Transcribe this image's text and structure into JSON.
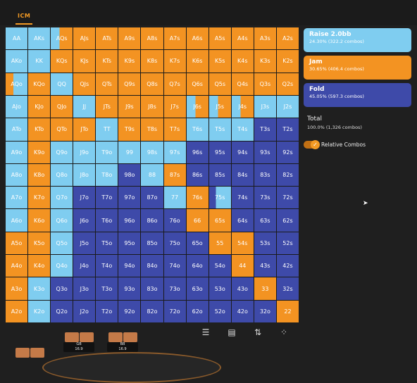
{
  "header": {
    "tab_label": "ICM"
  },
  "grid": {
    "rows": [
      [
        [
          "AA",
          "R"
        ],
        [
          "AKs",
          "R"
        ],
        [
          "AQs",
          "RJ"
        ],
        [
          "AJs",
          "J"
        ],
        [
          "ATs",
          "J"
        ],
        [
          "A9s",
          "J"
        ],
        [
          "A8s",
          "J"
        ],
        [
          "A7s",
          "J"
        ],
        [
          "A6s",
          "J"
        ],
        [
          "A5s",
          "J"
        ],
        [
          "A4s",
          "J"
        ],
        [
          "A3s",
          "J"
        ],
        [
          "A2s",
          "J"
        ]
      ],
      [
        [
          "AKo",
          "R"
        ],
        [
          "KK",
          "R"
        ],
        [
          "KQs",
          "J"
        ],
        [
          "KJs",
          "J"
        ],
        [
          "KTs",
          "J"
        ],
        [
          "K9s",
          "J"
        ],
        [
          "K8s",
          "J"
        ],
        [
          "K7s",
          "J"
        ],
        [
          "K6s",
          "J"
        ],
        [
          "K5s",
          "J"
        ],
        [
          "K4s",
          "J"
        ],
        [
          "K3s",
          "J"
        ],
        [
          "K2s",
          "J"
        ]
      ],
      [
        [
          "AQo",
          "JR"
        ],
        [
          "KQo",
          "J"
        ],
        [
          "QQ",
          "R"
        ],
        [
          "QJs",
          "J"
        ],
        [
          "QTs",
          "J"
        ],
        [
          "Q9s",
          "J"
        ],
        [
          "Q8s",
          "J"
        ],
        [
          "Q7s",
          "J"
        ],
        [
          "Q6s",
          "J"
        ],
        [
          "Q5s",
          "J"
        ],
        [
          "Q4s",
          "J"
        ],
        [
          "Q3s",
          "J"
        ],
        [
          "Q2s",
          "J"
        ]
      ],
      [
        [
          "AJo",
          "R"
        ],
        [
          "KJo",
          "J"
        ],
        [
          "QJo",
          "J"
        ],
        [
          "JJ",
          "R"
        ],
        [
          "JTs",
          "J"
        ],
        [
          "J9s",
          "J"
        ],
        [
          "J8s",
          "J"
        ],
        [
          "J7s",
          "J"
        ],
        [
          "J6s",
          "RJ"
        ],
        [
          "J5s",
          "RJ"
        ],
        [
          "J4s",
          "RJ"
        ],
        [
          "J3s",
          "R"
        ],
        [
          "J2s",
          "R"
        ]
      ],
      [
        [
          "ATo",
          "R"
        ],
        [
          "KTo",
          "J"
        ],
        [
          "QTo",
          "J"
        ],
        [
          "JTo",
          "J"
        ],
        [
          "TT",
          "R"
        ],
        [
          "T9s",
          "J"
        ],
        [
          "T8s",
          "J"
        ],
        [
          "T7s",
          "J"
        ],
        [
          "T6s",
          "R"
        ],
        [
          "T5s",
          "R"
        ],
        [
          "T4s",
          "R"
        ],
        [
          "T3s",
          "F"
        ],
        [
          "T2s",
          "F"
        ]
      ],
      [
        [
          "A9o",
          "R"
        ],
        [
          "K9o",
          "J"
        ],
        [
          "Q9o",
          "R"
        ],
        [
          "J9o",
          "R"
        ],
        [
          "T9o",
          "R"
        ],
        [
          "99",
          "R"
        ],
        [
          "98s",
          "R"
        ],
        [
          "97s",
          "R"
        ],
        [
          "96s",
          "F"
        ],
        [
          "95s",
          "F"
        ],
        [
          "94s",
          "F"
        ],
        [
          "93s",
          "F"
        ],
        [
          "92s",
          "F"
        ]
      ],
      [
        [
          "A8o",
          "R"
        ],
        [
          "K8o",
          "J"
        ],
        [
          "Q8o",
          "R"
        ],
        [
          "J8o",
          "R"
        ],
        [
          "T8o",
          "R"
        ],
        [
          "98o",
          "F"
        ],
        [
          "88",
          "R"
        ],
        [
          "87s",
          "J"
        ],
        [
          "86s",
          "F"
        ],
        [
          "85s",
          "F"
        ],
        [
          "84s",
          "F"
        ],
        [
          "83s",
          "F"
        ],
        [
          "82s",
          "F"
        ]
      ],
      [
        [
          "A7o",
          "R"
        ],
        [
          "K7o",
          "J"
        ],
        [
          "Q7o",
          "R"
        ],
        [
          "J7o",
          "F"
        ],
        [
          "T7o",
          "F"
        ],
        [
          "97o",
          "F"
        ],
        [
          "87o",
          "F"
        ],
        [
          "77",
          "R"
        ],
        [
          "76s",
          "J"
        ],
        [
          "75s",
          "FR"
        ],
        [
          "74s",
          "F"
        ],
        [
          "73s",
          "F"
        ],
        [
          "72s",
          "F"
        ]
      ],
      [
        [
          "A6o",
          "R"
        ],
        [
          "K6o",
          "J"
        ],
        [
          "Q6o",
          "R"
        ],
        [
          "J6o",
          "F"
        ],
        [
          "T6o",
          "F"
        ],
        [
          "96o",
          "F"
        ],
        [
          "86o",
          "F"
        ],
        [
          "76o",
          "F"
        ],
        [
          "66",
          "J"
        ],
        [
          "65s",
          "J"
        ],
        [
          "64s",
          "F"
        ],
        [
          "63s",
          "F"
        ],
        [
          "62s",
          "F"
        ]
      ],
      [
        [
          "A5o",
          "J"
        ],
        [
          "K5o",
          "J"
        ],
        [
          "Q5o",
          "R"
        ],
        [
          "J5o",
          "F"
        ],
        [
          "T5o",
          "F"
        ],
        [
          "95o",
          "F"
        ],
        [
          "85o",
          "F"
        ],
        [
          "75o",
          "F"
        ],
        [
          "65o",
          "F"
        ],
        [
          "55",
          "J"
        ],
        [
          "54s",
          "J"
        ],
        [
          "53s",
          "F"
        ],
        [
          "52s",
          "F"
        ]
      ],
      [
        [
          "A4o",
          "J"
        ],
        [
          "K4o",
          "J"
        ],
        [
          "Q4o",
          "R"
        ],
        [
          "J4o",
          "F"
        ],
        [
          "T4o",
          "F"
        ],
        [
          "94o",
          "F"
        ],
        [
          "84o",
          "F"
        ],
        [
          "74o",
          "F"
        ],
        [
          "64o",
          "F"
        ],
        [
          "54o",
          "F"
        ],
        [
          "44",
          "J"
        ],
        [
          "43s",
          "F"
        ],
        [
          "42s",
          "F"
        ]
      ],
      [
        [
          "A3o",
          "J"
        ],
        [
          "K3o",
          "R"
        ],
        [
          "Q3o",
          "F"
        ],
        [
          "J3o",
          "F"
        ],
        [
          "T3o",
          "F"
        ],
        [
          "93o",
          "F"
        ],
        [
          "83o",
          "F"
        ],
        [
          "73o",
          "F"
        ],
        [
          "63o",
          "F"
        ],
        [
          "53o",
          "F"
        ],
        [
          "43o",
          "F"
        ],
        [
          "33",
          "J"
        ],
        [
          "32s",
          "F"
        ]
      ],
      [
        [
          "A2o",
          "J"
        ],
        [
          "K2o",
          "R"
        ],
        [
          "Q2o",
          "F"
        ],
        [
          "J2o",
          "F"
        ],
        [
          "T2o",
          "F"
        ],
        [
          "92o",
          "F"
        ],
        [
          "82o",
          "F"
        ],
        [
          "72o",
          "F"
        ],
        [
          "62o",
          "F"
        ],
        [
          "52o",
          "F"
        ],
        [
          "42o",
          "F"
        ],
        [
          "32o",
          "F"
        ],
        [
          "22",
          "J"
        ]
      ]
    ]
  },
  "legend": {
    "raise": {
      "title": "Raise 2.0bb",
      "sub": "24.30% (322.2 combos)",
      "color": "#7fcdf0"
    },
    "jam": {
      "title": "Jam",
      "sub": "30.65% (406.4 combos)",
      "color": "#f39322"
    },
    "fold": {
      "title": "Fold",
      "sub": "45.05% (597.3 combos)",
      "color": "#3e4aa9"
    }
  },
  "total": {
    "label": "Total",
    "value": "100.0% (1,326 combos)"
  },
  "relative_combos": {
    "label": "Relative Combos",
    "enabled": true
  },
  "toolbar": {
    "icons": [
      "list-icon",
      "table-icon",
      "sort-icon",
      "scatter-icon"
    ]
  },
  "players": [
    {
      "label": "GB",
      "stack": "16.9"
    },
    {
      "label": "BB",
      "stack": "16.9"
    }
  ]
}
